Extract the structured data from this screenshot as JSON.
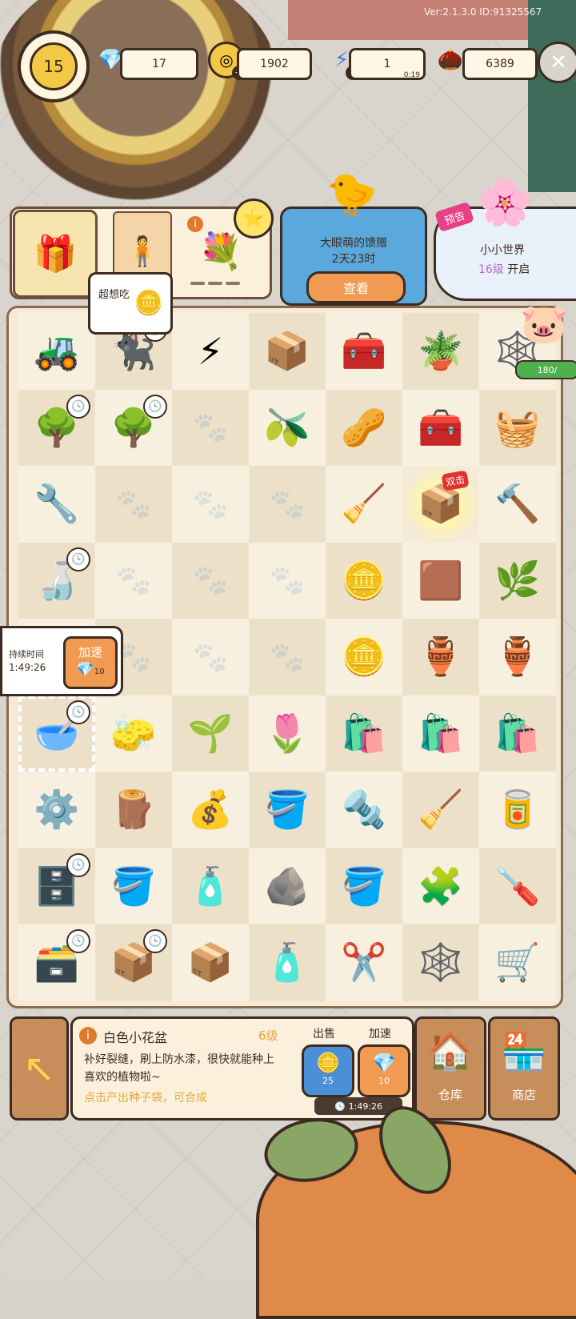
{
  "version": "Ver:2.1.3.0 ID:91325567",
  "player": {
    "level": "15"
  },
  "resources": {
    "gems": {
      "value": "17",
      "icon": "gem-icon"
    },
    "coins": {
      "value": "1902",
      "icon": "coin-icon"
    },
    "energy": {
      "value": "1",
      "timer": "0:19",
      "icon": "lightning-icon"
    },
    "seeds": {
      "value": "6389",
      "icon": "sunflower-seed-icon"
    }
  },
  "quick_items": [
    {
      "name": "gift-box",
      "glyph": "🎁"
    },
    {
      "name": "tag-card",
      "glyph": "🧍"
    },
    {
      "name": "flower-pot",
      "glyph": "💐"
    }
  ],
  "events": {
    "gift": {
      "title": "大眼萌的馈赠",
      "time": "2天23时",
      "button": "查看"
    },
    "world": {
      "tag": "预告",
      "title": "小小世界",
      "level": "16级",
      "suffix": "开启"
    }
  },
  "bubble": {
    "text": "超想吃"
  },
  "piggy_bank": {
    "progress": "180/"
  },
  "speedup_popup": {
    "label": "持续时间",
    "time": "1:49:26",
    "button": "加速",
    "cost": "10"
  },
  "board": {
    "cells": [
      [
        "🚜",
        "🐈‍⬛",
        "⚡",
        "📦",
        "🧰",
        "🪴",
        "🕸️"
      ],
      [
        "🌳",
        "🌳",
        "",
        "🫒",
        "🥜",
        "🧰",
        "🧺"
      ],
      [
        "🔧",
        "",
        "",
        "",
        "🧹",
        "📦",
        "🔨"
      ],
      [
        "🍶",
        "",
        "",
        "",
        "🪙",
        "🟫",
        "🌿"
      ],
      [
        "",
        "",
        "",
        "",
        "🪙",
        "🏺",
        "🏺"
      ],
      [
        "🥣",
        "🧽",
        "🌱",
        "🌷",
        "🛍️",
        "🛍️",
        "🛍️"
      ],
      [
        "⚙️",
        "🪵",
        "💰",
        "🪣",
        "🔩",
        "🧹",
        "🥫"
      ],
      [
        "🗄️",
        "🪣",
        "🧴",
        "🪨",
        "🪣",
        "🧩",
        "🪛"
      ],
      [
        "🗃️",
        "📦",
        "📦",
        "🧴",
        "✂️",
        "🕸️",
        "🛒"
      ]
    ],
    "timers": [
      [
        0,
        1
      ],
      [
        1,
        0
      ],
      [
        1,
        1
      ],
      [
        3,
        0
      ],
      [
        5,
        0
      ],
      [
        7,
        0
      ],
      [
        8,
        0
      ],
      [
        8,
        1
      ]
    ],
    "double_tag": "双击"
  },
  "item_info": {
    "name": "白色小花盆",
    "level": "6级",
    "description": "补好裂缝，刷上防水漆，很快就能种上喜欢的植物啦~",
    "hint": "点击产出种子袋，可合成",
    "sell_label": "出售",
    "sell_value": "25",
    "boost_label": "加速",
    "boost_value": "10",
    "timer": "1:49:26"
  },
  "nav": {
    "warehouse": "仓库",
    "shop": "商店"
  }
}
